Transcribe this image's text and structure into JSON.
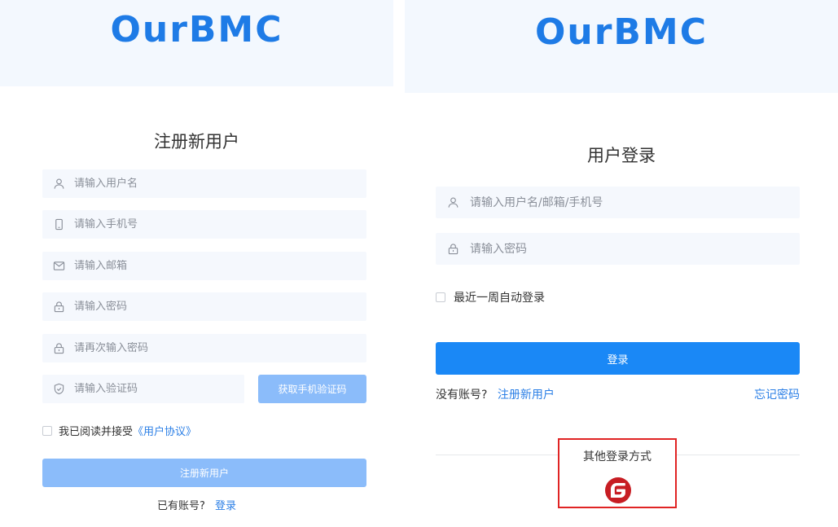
{
  "brand": {
    "logo_text": "OurBMC",
    "logo_color": "#1e7be6"
  },
  "register": {
    "title": "注册新用户",
    "fields": [
      {
        "icon": "user-icon",
        "placeholder": "请输入用户名"
      },
      {
        "icon": "phone-icon",
        "placeholder": "请输入手机号"
      },
      {
        "icon": "mail-icon",
        "placeholder": "请输入邮箱"
      },
      {
        "icon": "lock-icon",
        "placeholder": "请输入密码"
      },
      {
        "icon": "lock-icon",
        "placeholder": "请再次输入密码"
      },
      {
        "icon": "shield-icon",
        "placeholder": "请输入验证码"
      }
    ],
    "sms_button": "获取手机验证码",
    "agree_text": "我已阅读并接受",
    "agreement_link": "《用户协议》",
    "submit": "注册新用户",
    "have_account": "已有账号?",
    "login_link": "登录"
  },
  "login": {
    "title": "用户登录",
    "fields": [
      {
        "icon": "user-icon",
        "placeholder": "请输入用户名/邮箱/手机号"
      },
      {
        "icon": "lock-icon",
        "placeholder": "请输入密码"
      }
    ],
    "remember": "最近一周自动登录",
    "submit": "登录",
    "no_account": "没有账号?",
    "register_link": "注册新用户",
    "forgot_link": "忘记密码",
    "other_methods": "其他登录方式",
    "other_icon": "gitee-icon"
  },
  "colors": {
    "banner_bg": "#f3f8fe",
    "field_bg": "#f5f8fd",
    "primary": "#1a88f6",
    "primary_disabled": "#8bbcfa",
    "link": "#2b7fe6",
    "highlight_border": "#e02424",
    "gitee_red": "#c71d23"
  }
}
